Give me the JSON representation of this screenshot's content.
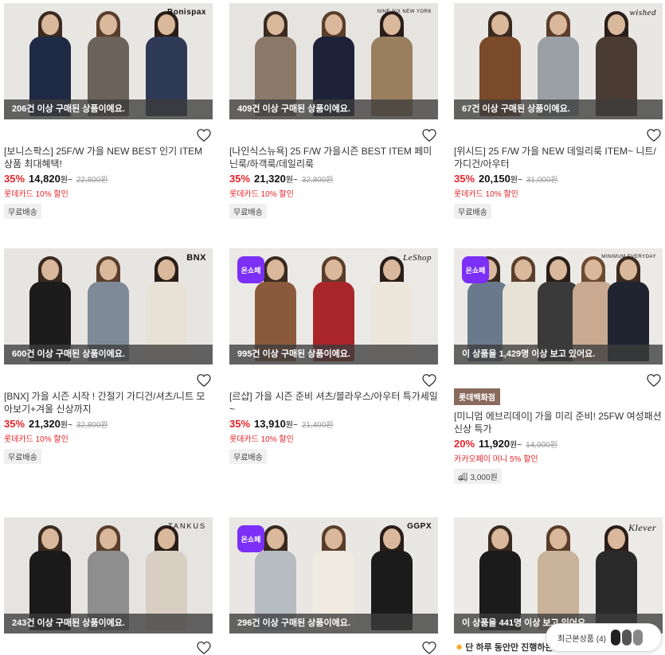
{
  "products": [
    {
      "brand": "Bonispax",
      "onsale": false,
      "sold": "206건 이상 구매된 상품이에요.",
      "title": "[보니스팍스] 25F/W 가을 NEW BEST 인기 ITEM 상품 최대혜택!",
      "discount": "35%",
      "price": "14,820",
      "won": "원~",
      "orig": "22,800원",
      "card_promo": "롯데카드 10% 할인",
      "ship": "무료배송",
      "bg": "#e8e6e3",
      "outfits": [
        "#1f2a44",
        "#6b6259",
        "#2e3a55"
      ]
    },
    {
      "brand": "NINE SIX NEW YORK",
      "onsale": false,
      "sold": "409건 이상 구매된 상품이에요.",
      "title": "[나인식스뉴욕] 25 F/W 가을시즌 BEST ITEM 페미닌룩/하객룩/데일리룩",
      "discount": "35%",
      "price": "21,320",
      "won": "원~",
      "orig": "32,800원",
      "card_promo": "롯데카드 10% 할인",
      "ship": "무료배송",
      "bg": "#e6e4e0",
      "outfits": [
        "#8a7868",
        "#1e2238",
        "#9a7f5e"
      ]
    },
    {
      "brand": "wished",
      "onsale": false,
      "sold": "67건 이상 구매된 상품이에요.",
      "title": "[위시드] 25 F/W 가을 NEW 데일리룩 ITEM~ 니트/가디건/아우터",
      "discount": "35%",
      "price": "20,150",
      "won": "원~",
      "orig": "31,000원",
      "card_promo": "롯데카드 10% 할인",
      "ship": "무료배송",
      "bg": "#e9e7e4",
      "outfits": [
        "#7a4a2a",
        "#9aa0a6",
        "#4a3b33"
      ]
    },
    {
      "brand": "BNX",
      "onsale": false,
      "sold": "600건 이상 구매된 상품이에요.",
      "title": "[BNX] 가을 시즌 시작 ! 간절기 가디건/셔츠/니트 모아보기+겨울 신상까지",
      "discount": "35%",
      "price": "21,320",
      "won": "원~",
      "orig": "32,800원",
      "card_promo": "롯데카드 10% 할인",
      "ship": "무료배송",
      "bg": "#e7e5e2",
      "outfits": [
        "#1c1c1c",
        "#7f8a99",
        "#e8e2d6"
      ]
    },
    {
      "brand": "LeShop",
      "onsale": true,
      "onsale_label": "온쇼페",
      "sold": "995건 이상 구매된 상품이에요.",
      "title": "[르샵] 가을 시즌 준비 셔츠/블라우스/아우터 특가세일~",
      "discount": "35%",
      "price": "13,910",
      "won": "원~",
      "orig": "21,400원",
      "card_promo": "롯데카드 10% 할인",
      "ship": "무료배송",
      "bg": "#ebe9e6",
      "outfits": [
        "#8b5a3c",
        "#a8262a",
        "#ede6da"
      ]
    },
    {
      "brand": "MINIMUM EVERYDAY",
      "onsale": true,
      "onsale_label": "온쇼페",
      "sold": "이 상품을 1,429명 이상 보고 있어요.",
      "badge": "롯데백화점",
      "title": "[미니멈 에브리데이] 가을 미리 준비! 25FW 여성패션 신상 특가",
      "discount": "20%",
      "price": "11,920",
      "won": "원~",
      "orig": "14,900원",
      "card_promo": "카카오페이 머니 5% 할인",
      "ship": "3,000원",
      "bg": "#eceae7",
      "outfits": [
        "#6a7a8c",
        "#e8e2d6",
        "#3a3a3a",
        "#c9a98f",
        "#1f2430"
      ]
    },
    {
      "brand": "TANKUS",
      "onsale": false,
      "sold": "243건 이상 구매된 상품이에요.",
      "bg": "#e6e4e1",
      "outfits": [
        "#1a1a1a",
        "#8e8e8e",
        "#d8cfc2"
      ]
    },
    {
      "brand": "GGPX",
      "onsale": true,
      "onsale_label": "온쇼페",
      "sold": "296건 이상 구매된 상품이에요.",
      "bg": "#e9e7e4",
      "outfits": [
        "#b7bcc2",
        "#f0ebe1",
        "#1b1b1b"
      ]
    },
    {
      "brand": "Klever",
      "onsale": false,
      "sold": "이 상품을 441명 이상 보고 있어요.",
      "bg": "#eceae7",
      "outfits": [
        "#1b1b1b",
        "#c9b39a",
        "#2a2a2a"
      ]
    }
  ],
  "bottom_note": "단 하루 동안만 진행하는 특",
  "recent": {
    "label": "최근본상품 (4)"
  }
}
